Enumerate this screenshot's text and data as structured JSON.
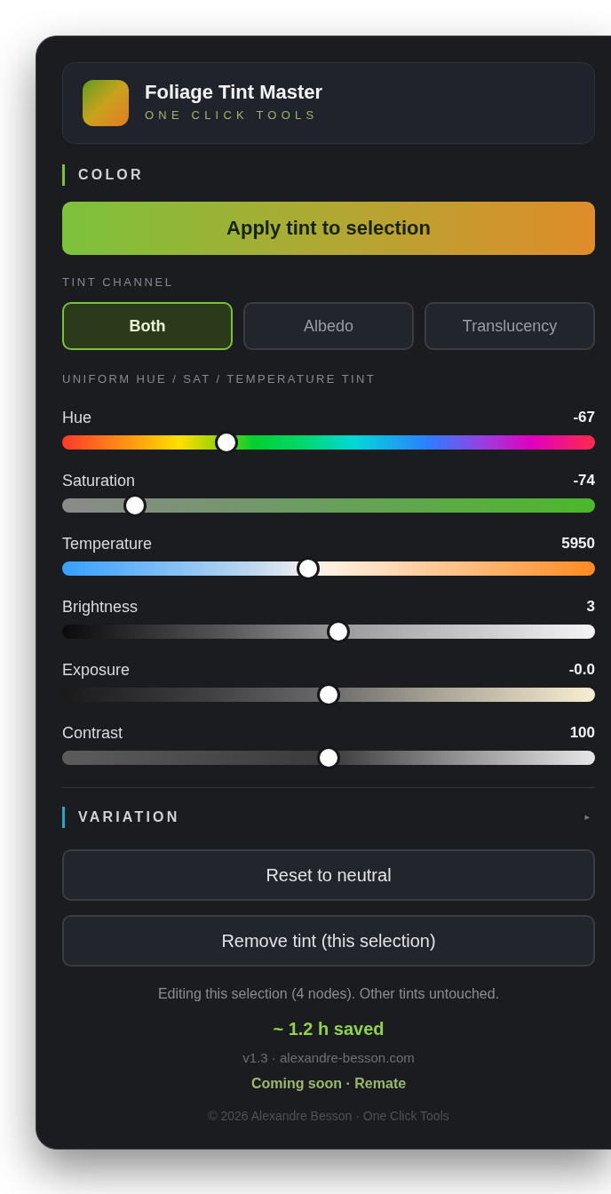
{
  "header": {
    "title": "Foliage Tint Master",
    "subtitle": "ONE CLICK TOOLS"
  },
  "color_section": {
    "title": "COLOR",
    "apply_button": "Apply tint to selection",
    "channel_label": "TINT CHANNEL",
    "channels": [
      {
        "label": "Both",
        "selected": true
      },
      {
        "label": "Albedo",
        "selected": false
      },
      {
        "label": "Translucency",
        "selected": false
      }
    ],
    "sliders_label": "UNIFORM HUE / SAT / TEMPERATURE TINT",
    "sliders": [
      {
        "kind": "hue",
        "label": "Hue",
        "reading": "-67",
        "level": 0.3
      },
      {
        "kind": "saturation",
        "label": "Saturation",
        "reading": "-74",
        "level": 0.12
      },
      {
        "kind": "temperature",
        "label": "Temperature",
        "reading": "5950",
        "level": 0.46
      },
      {
        "kind": "brightness",
        "label": "Brightness",
        "reading": "3",
        "level": 0.52
      },
      {
        "kind": "exposure",
        "label": "Exposure",
        "reading": "-0.0",
        "level": 0.5
      },
      {
        "kind": "contrast",
        "label": "Contrast",
        "reading": "100",
        "level": 0.5
      }
    ]
  },
  "variation_section": {
    "title": "VARIATION",
    "toggle": "▸",
    "expanded": false
  },
  "buttons": [
    "Reset to neutral",
    "Remove tint (this selection)"
  ],
  "footer": {
    "note": "Editing this selection (4 nodes). Other tints untouched.",
    "saved": "~ 1.2 h saved",
    "version": "v1.3 · alexandre-besson.com",
    "coming_soon": "Coming soon · Remate",
    "copyright": "© 2026 Alexandre Besson · One Click Tools"
  }
}
